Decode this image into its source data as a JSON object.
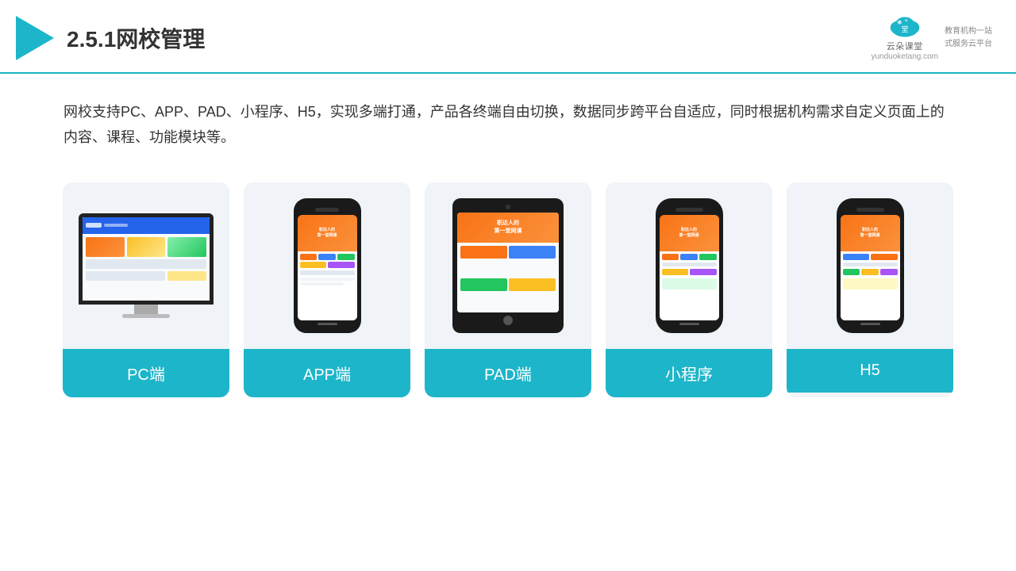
{
  "header": {
    "title": "2.5.1网校管理",
    "brand": {
      "name": "云朵课堂",
      "domain": "yunduoketang.com",
      "slogan_line1": "教育机构一站",
      "slogan_line2": "式服务云平台"
    }
  },
  "description": {
    "text": "网校支持PC、APP、PAD、小程序、H5，实现多端打通，产品各终端自由切换，数据同步跨平台自适应，同时根据机构需求自定义页面上的内容、课程、功能模块等。"
  },
  "cards": [
    {
      "id": "pc",
      "label": "PC端"
    },
    {
      "id": "app",
      "label": "APP端"
    },
    {
      "id": "pad",
      "label": "PAD端"
    },
    {
      "id": "mini",
      "label": "小程序"
    },
    {
      "id": "h5",
      "label": "H5"
    }
  ],
  "colors": {
    "teal": "#1db5c9",
    "dark_text": "#333333",
    "light_bg": "#f0f4f8",
    "card_label_bg": "#1db5c9"
  }
}
